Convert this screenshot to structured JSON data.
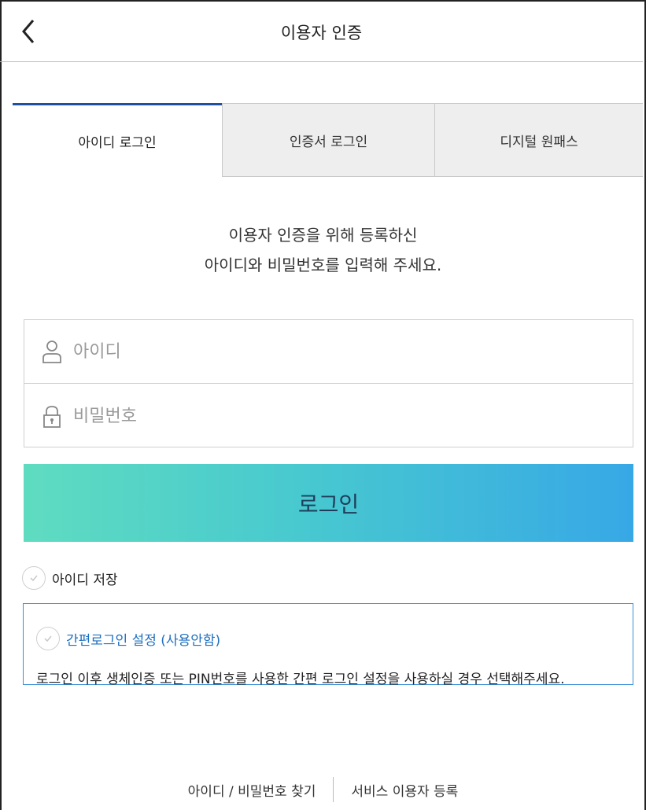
{
  "header": {
    "title": "이용자 인증"
  },
  "tabs": [
    {
      "label": "아이디 로그인",
      "active": true
    },
    {
      "label": "인증서 로그인",
      "active": false
    },
    {
      "label": "디지털 원패스",
      "active": false
    }
  ],
  "guide": {
    "line1": "이용자 인증을 위해 등록하신",
    "line2": "아이디와 비밀번호를 입력해 주세요."
  },
  "form": {
    "id_placeholder": "아이디",
    "pw_placeholder": "비밀번호",
    "id_value": "",
    "pw_value": ""
  },
  "login_button": {
    "label": "로그인"
  },
  "save_id": {
    "label": "아이디 저장",
    "checked": false
  },
  "simple_login": {
    "label": "간편로그인 설정 (사용안함)",
    "description": "로그인 이후 생체인증 또는 PIN번호를 사용한 간편 로그인 설정을 사용하실 경우 선택해주세요.",
    "checked": false
  },
  "footer": {
    "find_link": "아이디 / 비밀번호 찾기",
    "register_link": "서비스 이용자 등록"
  },
  "colors": {
    "tab_active_border": "#1f4f9f",
    "login_gradient_start": "#5fdcc0",
    "login_gradient_end": "#37a8e6",
    "simple_box_border": "#3a8fd6",
    "simple_label": "#1d6fc0"
  },
  "icons": {
    "back": "chevron-left-icon",
    "id_field": "user-icon",
    "pw_field": "lock-icon",
    "check": "check-icon"
  }
}
